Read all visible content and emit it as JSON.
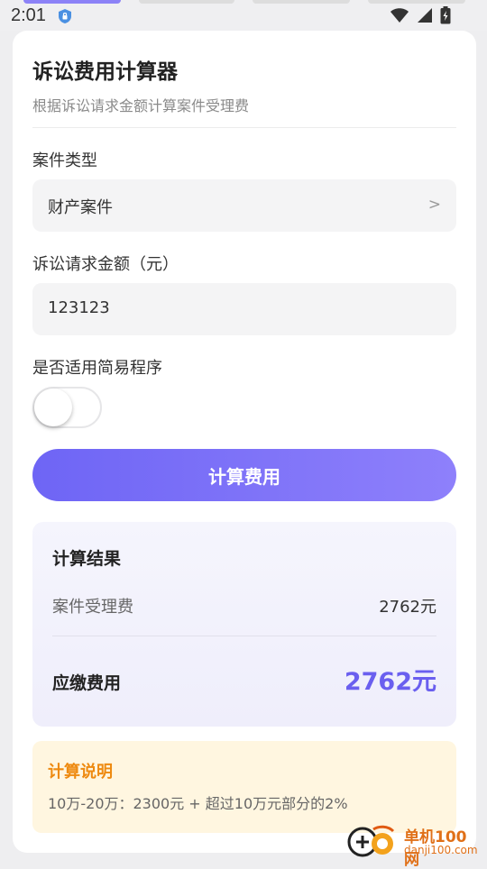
{
  "status_bar": {
    "time": "2:01"
  },
  "form": {
    "title": "诉讼费用计算器",
    "subtitle": "根据诉讼请求金额计算案件受理费",
    "case_type_label": "案件类型",
    "case_type_value": "财产案件",
    "case_type_arrow": ">",
    "amount_label": "诉讼请求金额（元）",
    "amount_value": "123123",
    "simple_procedure_label": "是否适用简易程序",
    "simple_procedure_enabled": false,
    "calculate_button": "计算费用"
  },
  "result": {
    "title": "计算结果",
    "fee_label": "案件受理费",
    "fee_value": "2762元",
    "total_label": "应缴费用",
    "total_value": "2762元"
  },
  "note": {
    "title": "计算说明",
    "text": "10万-20万：2300元 + 超过10万元部分的2%"
  },
  "watermark": {
    "line1": "单机100网",
    "line2": "danji100.com"
  },
  "colors": {
    "accent": "#6a5fef",
    "note_title": "#ee8a10",
    "note_bg": "#fff6e0"
  }
}
